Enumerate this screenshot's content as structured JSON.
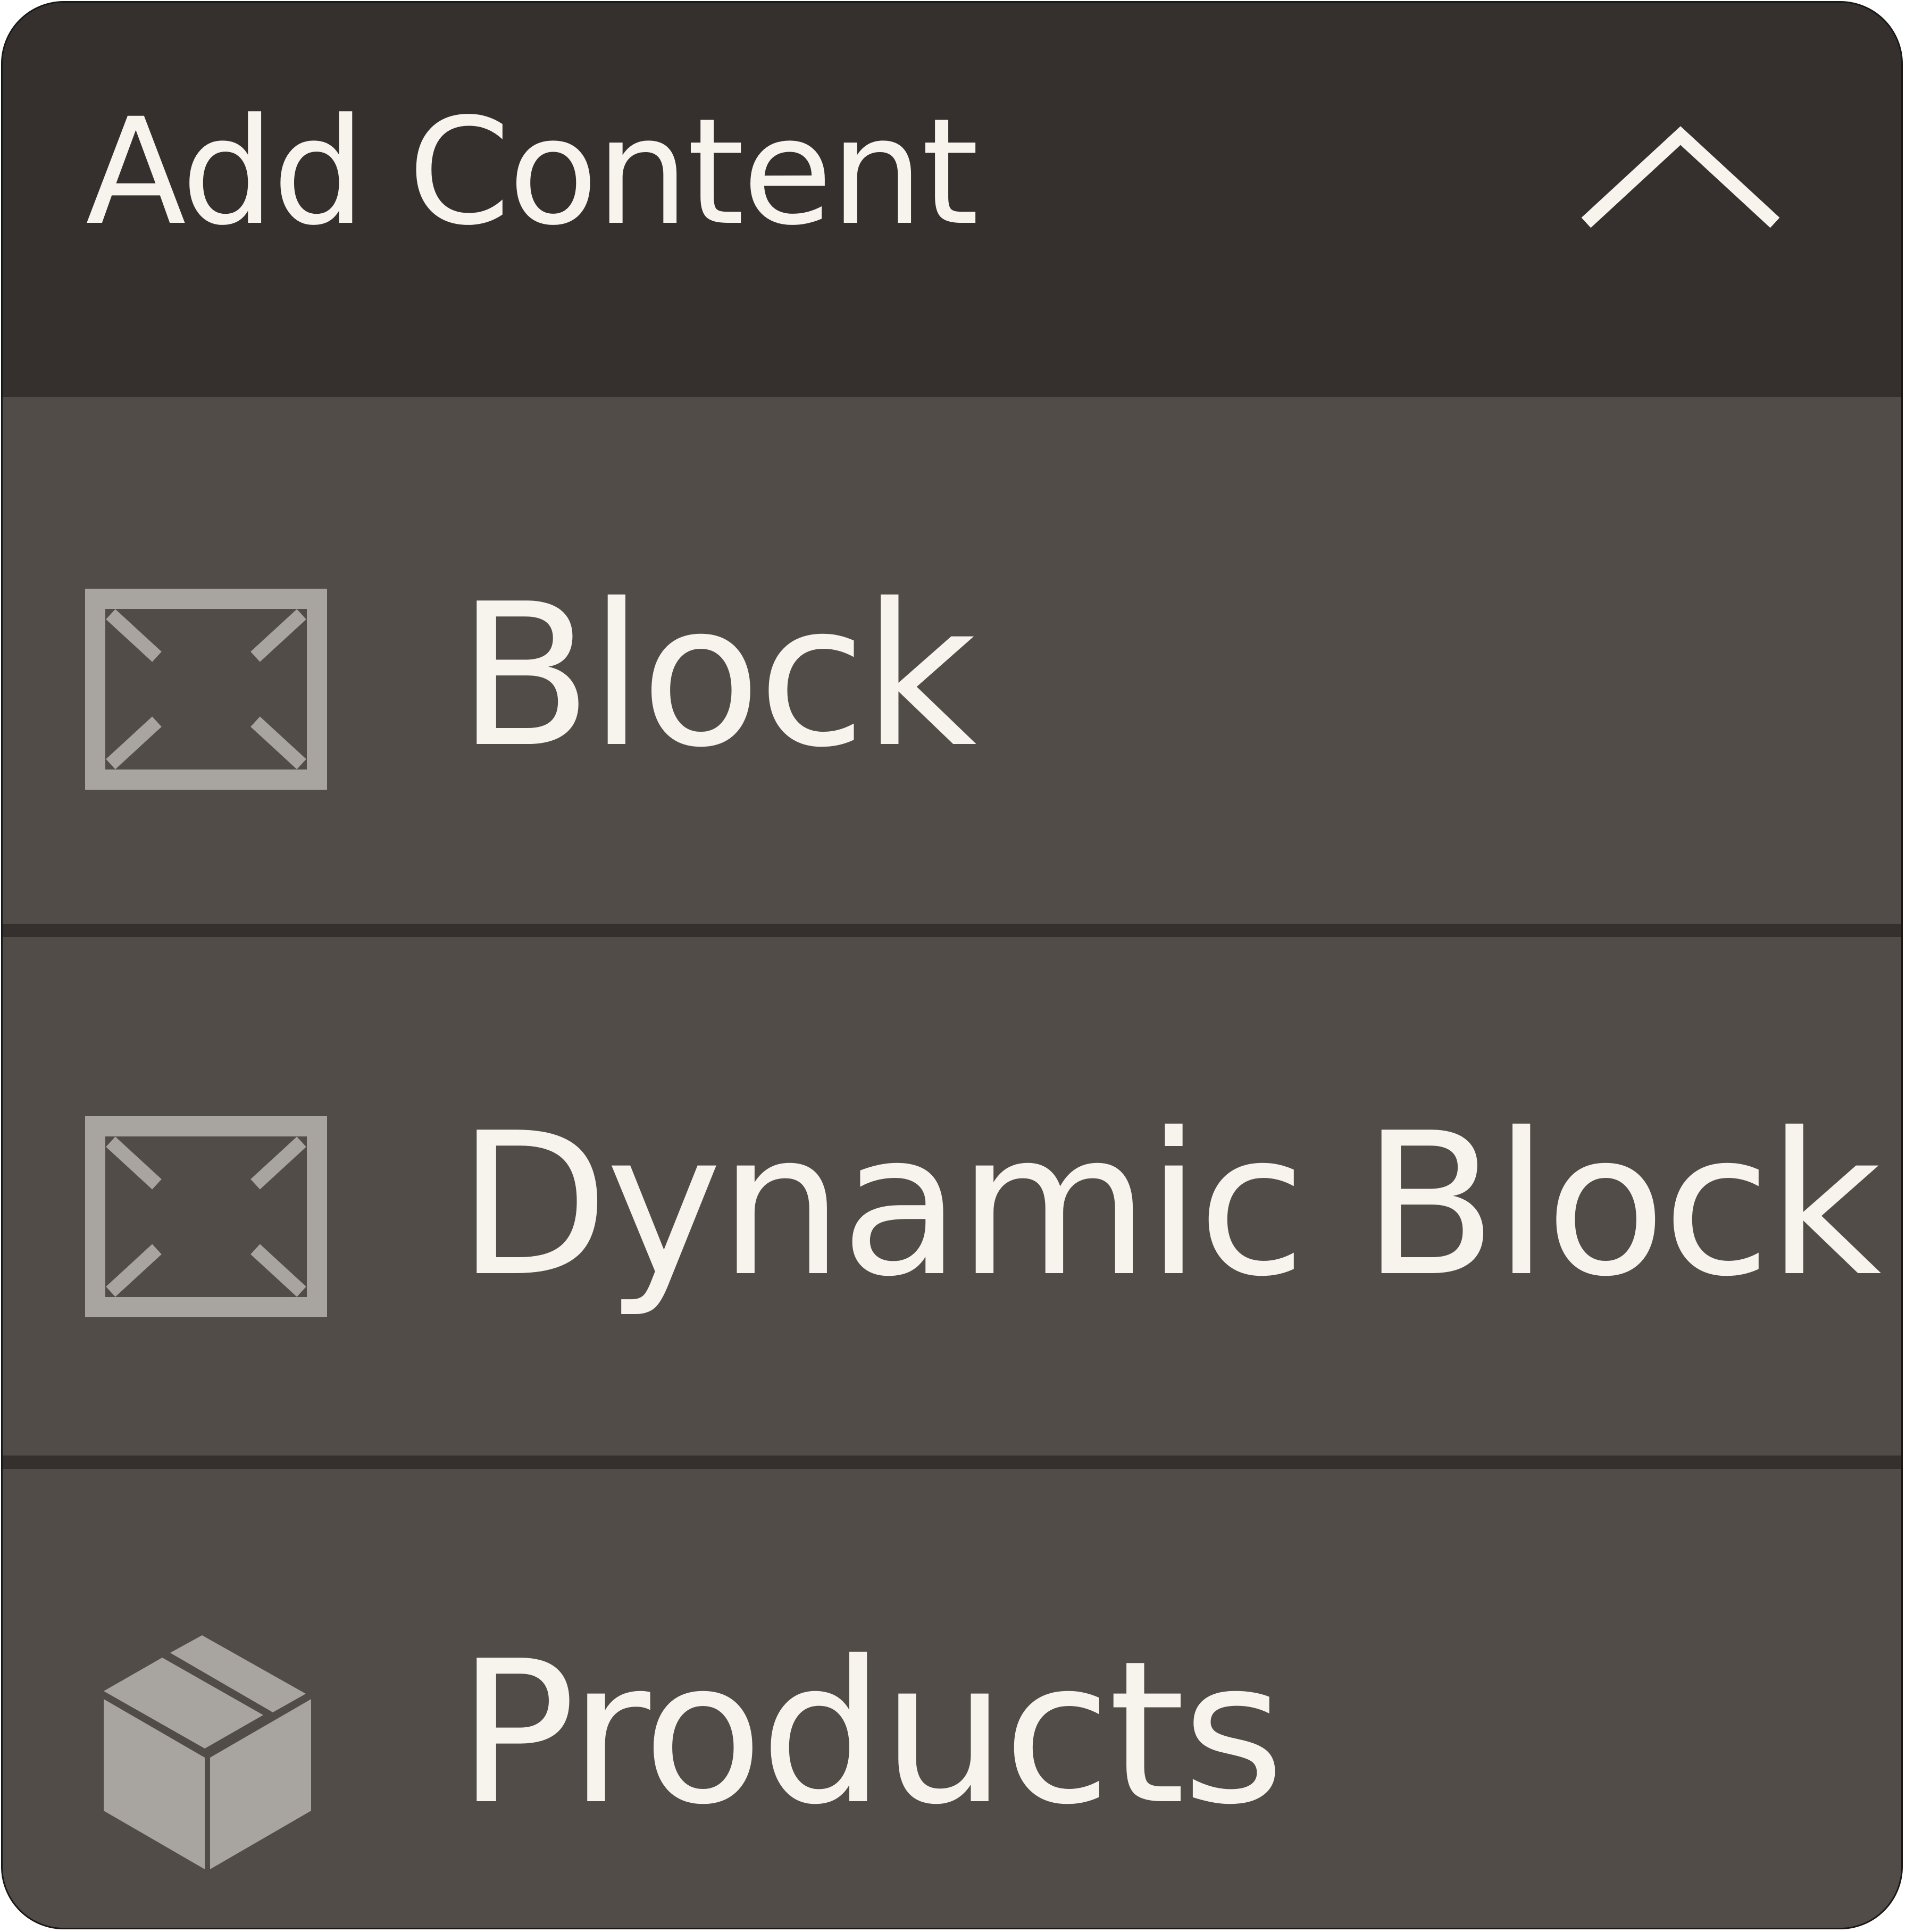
{
  "panel": {
    "title": "Add Content",
    "toggle_icon": "chevron-up-icon",
    "colors": {
      "header_bg": "#35302d",
      "item_bg": "#514c48",
      "text": "#f7f3ed",
      "icon": "#a8a49f"
    }
  },
  "items": [
    {
      "label": "Block",
      "icon": "block-icon"
    },
    {
      "label": "Dynamic Block",
      "icon": "dynamic-block-icon"
    },
    {
      "label": "Products",
      "icon": "products-box-icon"
    }
  ]
}
